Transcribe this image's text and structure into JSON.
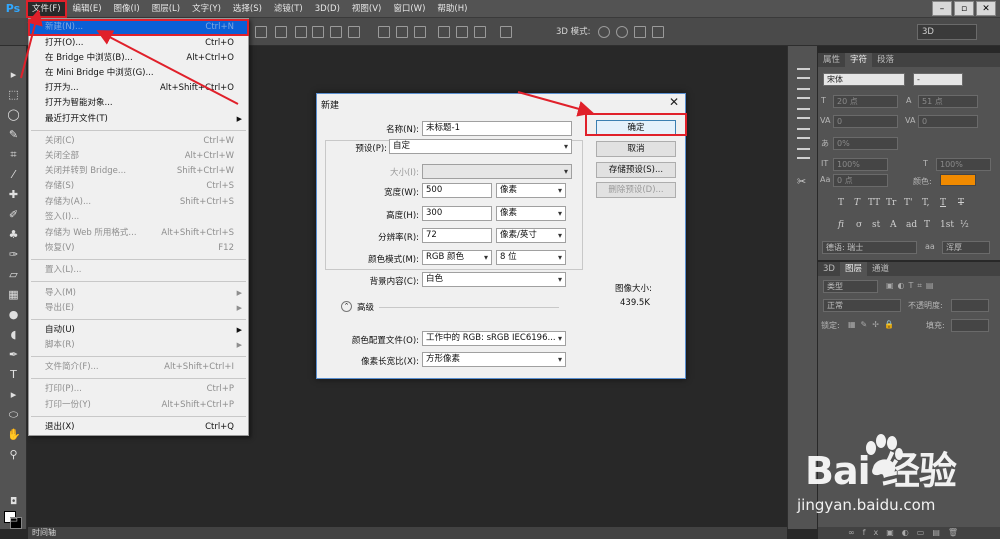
{
  "app": {
    "logo": "Ps",
    "menus": [
      "文件(F)",
      "编辑(E)",
      "图像(I)",
      "图层(L)",
      "文字(Y)",
      "选择(S)",
      "滤镜(T)",
      "3D(D)",
      "视图(V)",
      "窗口(W)",
      "帮助(H)"
    ],
    "window_controls": [
      "–",
      "▫",
      "✕"
    ]
  },
  "options_bar": {
    "mode_label": "3D 模式:",
    "mode_select": "3D"
  },
  "file_menu": {
    "items": [
      {
        "label": "新建(N)...",
        "shortcut": "Ctrl+N"
      },
      {
        "label": "打开(O)...",
        "shortcut": "Ctrl+O"
      },
      {
        "label": "在 Bridge 中浏览(B)...",
        "shortcut": "Alt+Ctrl+O"
      },
      {
        "label": "在 Mini Bridge 中浏览(G)...",
        "shortcut": ""
      },
      {
        "label": "打开为...",
        "shortcut": "Alt+Shift+Ctrl+O"
      },
      {
        "label": "打开为智能对象...",
        "shortcut": ""
      },
      {
        "label": "最近打开文件(T)",
        "shortcut": ""
      },
      {
        "label": "关闭(C)",
        "shortcut": "Ctrl+W"
      },
      {
        "label": "关闭全部",
        "shortcut": "Alt+Ctrl+W"
      },
      {
        "label": "关闭并转到 Bridge...",
        "shortcut": "Shift+Ctrl+W"
      },
      {
        "label": "存储(S)",
        "shortcut": "Ctrl+S"
      },
      {
        "label": "存储为(A)...",
        "shortcut": "Shift+Ctrl+S"
      },
      {
        "label": "签入(I)...",
        "shortcut": ""
      },
      {
        "label": "存储为 Web 所用格式...",
        "shortcut": "Alt+Shift+Ctrl+S"
      },
      {
        "label": "恢复(V)",
        "shortcut": "F12"
      },
      {
        "label": "置入(L)...",
        "shortcut": ""
      },
      {
        "label": "导入(M)",
        "shortcut": ""
      },
      {
        "label": "导出(E)",
        "shortcut": ""
      },
      {
        "label": "自动(U)",
        "shortcut": ""
      },
      {
        "label": "脚本(R)",
        "shortcut": ""
      },
      {
        "label": "文件简介(F)...",
        "shortcut": "Alt+Shift+Ctrl+I"
      },
      {
        "label": "打印(P)...",
        "shortcut": "Ctrl+P"
      },
      {
        "label": "打印一份(Y)",
        "shortcut": "Alt+Shift+Ctrl+P"
      },
      {
        "label": "退出(X)",
        "shortcut": "Ctrl+Q"
      }
    ]
  },
  "dialog": {
    "title": "新建",
    "close": "✕",
    "name_label": "名称(N):",
    "name_value": "未标题-1",
    "preset_label": "预设(P):",
    "preset_value": "自定",
    "size_label": "大小(I):",
    "size_value": "",
    "width_label": "宽度(W):",
    "width_value": "500",
    "width_unit": "像素",
    "height_label": "高度(H):",
    "height_value": "300",
    "height_unit": "像素",
    "resolution_label": "分辨率(R):",
    "resolution_value": "72",
    "resolution_unit": "像素/英寸",
    "color_mode_label": "颜色模式(M):",
    "color_mode_value": "RGB 颜色",
    "bit_depth_value": "8 位",
    "bg_label": "背景内容(C):",
    "bg_value": "白色",
    "advanced_label": "高级",
    "profile_label": "颜色配置文件(O):",
    "profile_value": "工作中的 RGB: sRGB IEC6196...",
    "aspect_label": "像素长宽比(X):",
    "aspect_value": "方形像素",
    "ok": "确定",
    "cancel": "取消",
    "save_preset": "存储预设(S)...",
    "delete_preset": "删除预设(D)...",
    "image_size_label": "图像大小:",
    "image_size_value": "439.5K"
  },
  "char_panel": {
    "tabs": [
      "属性",
      "字符",
      "段落"
    ],
    "font_family": "宋体",
    "font_style": "-",
    "font_size": "20 点",
    "leading": "51 点",
    "kerning": "0",
    "tracking": "0",
    "scale_shift": "0%",
    "vscale": "100%",
    "hscale": "100%",
    "baseline": "0 点",
    "color_label": "颜色:",
    "color_value": "#f08a00",
    "type_buttons": [
      "T",
      "T",
      "TT",
      "Tr",
      "T'",
      "T,",
      "T",
      "T"
    ],
    "ot_buttons": [
      "fi",
      "σ",
      "st",
      "A",
      "ad",
      "T",
      "1st",
      "½"
    ],
    "language": "德语: 瑞士",
    "antialias_icon": "aa",
    "antialias": "浑厚"
  },
  "layers_panel": {
    "tabs": [
      "3D",
      "图层",
      "通道"
    ],
    "filter_label": "类型",
    "blend_mode": "正常",
    "opacity_label": "不透明度:",
    "lock_label": "锁定:",
    "fill_label": "填充:"
  },
  "timeline": {
    "tab": "时间轴"
  },
  "watermark": {
    "brand": "Bai 经验",
    "url": "jingyan.baidu.com"
  }
}
